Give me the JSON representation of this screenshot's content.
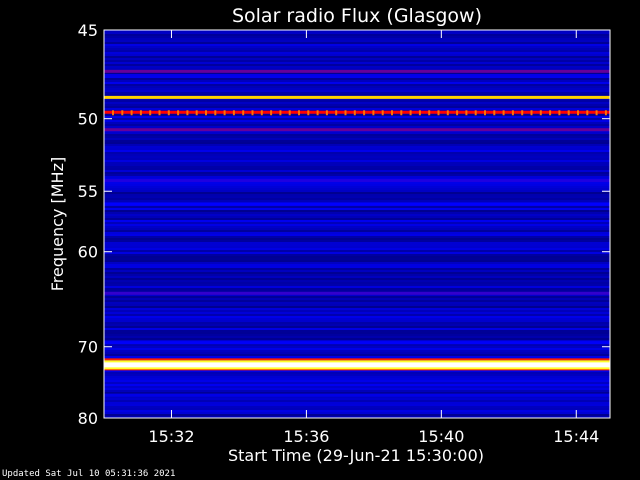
{
  "chart_data": {
    "type": "heatmap",
    "title": "Solar radio Flux (Glasgow)",
    "ylabel": "Frequency [MHz]",
    "xlabel": "Start Time (29-Jun-21 15:30:00)",
    "ylim": [
      45,
      80
    ],
    "y_scale": "reciprocal",
    "y_ticks": [
      "45",
      "50",
      "55",
      "60",
      "70",
      "80"
    ],
    "xlim": [
      "15:30:00",
      "15:45:00"
    ],
    "x_ticks": [
      "15:32",
      "15:36",
      "15:40",
      "15:44"
    ],
    "colormap": [
      "#000022",
      "#0000ff",
      "#ff0000",
      "#ffff00",
      "#ffffff"
    ],
    "bands": [
      {
        "mhz": 47.2,
        "intensity": 0.55
      },
      {
        "mhz": 48.7,
        "intensity": 0.85
      },
      {
        "mhz": 49.6,
        "intensity": 0.7
      },
      {
        "mhz": 50.7,
        "intensity": 0.55
      },
      {
        "mhz": 54.2,
        "intensity": 0.48
      },
      {
        "mhz": 56.0,
        "intensity": 0.45
      },
      {
        "mhz": 64.0,
        "intensity": 0.5
      },
      {
        "mhz": 69.5,
        "intensity": 0.44
      },
      {
        "mhz": 72.3,
        "intensity": 1.0
      },
      {
        "mhz": 76.5,
        "intensity": 0.4
      }
    ]
  },
  "footer": {
    "updated": "Updated Sat Jul 10 05:31:36 2021"
  }
}
